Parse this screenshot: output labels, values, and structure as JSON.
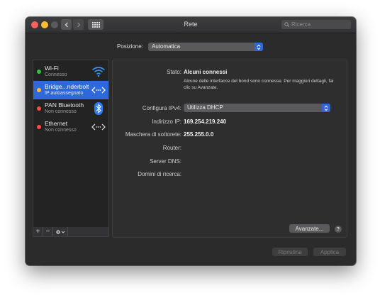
{
  "window": {
    "title": "Rete"
  },
  "search": {
    "placeholder": "Ricerca"
  },
  "location": {
    "label": "Posizione:",
    "value": "Automatica"
  },
  "services": [
    {
      "name": "Wi-Fi",
      "status": "Connesso",
      "dot_color": "#28c840",
      "icon": "wifi-icon"
    },
    {
      "name": "Bridge...nderbolt",
      "status": "IP autoassegnato",
      "dot_color": "#febc2e",
      "icon": "thunderbolt-bridge-icon",
      "selected": true
    },
    {
      "name": "PAN Bluetooth",
      "status": "Non connesso",
      "dot_color": "#fe4b44",
      "icon": "bluetooth-icon"
    },
    {
      "name": "Ethernet",
      "status": "Non connesso",
      "dot_color": "#fe4b44",
      "icon": "ethernet-icon"
    }
  ],
  "sidebar_tools": {
    "add": "+",
    "remove": "−"
  },
  "detail": {
    "status_label": "Stato:",
    "status_value": "Alcuni connessi",
    "status_description": "Alcune delle interfacce del bond sono connesse. Per maggiori dettagli, fai clic su Avanzate.",
    "ipv4_label": "Configura IPv4:",
    "ipv4_value": "Utilizza DHCP",
    "ip_label": "Indirizzo IP:",
    "ip_value": "169.254.219.240",
    "mask_label": "Maschera di sottorete:",
    "mask_value": "255.255.0.0",
    "router_label": "Router:",
    "dns_label": "Server DNS:",
    "domains_label": "Domini di ricerca:",
    "advanced_button": "Avanzate...",
    "help": "?"
  },
  "footer": {
    "revert": "Ripristina",
    "apply": "Applica"
  },
  "colors": {
    "accent": "#2f68d8",
    "window_bg": "#2b2b2c"
  }
}
